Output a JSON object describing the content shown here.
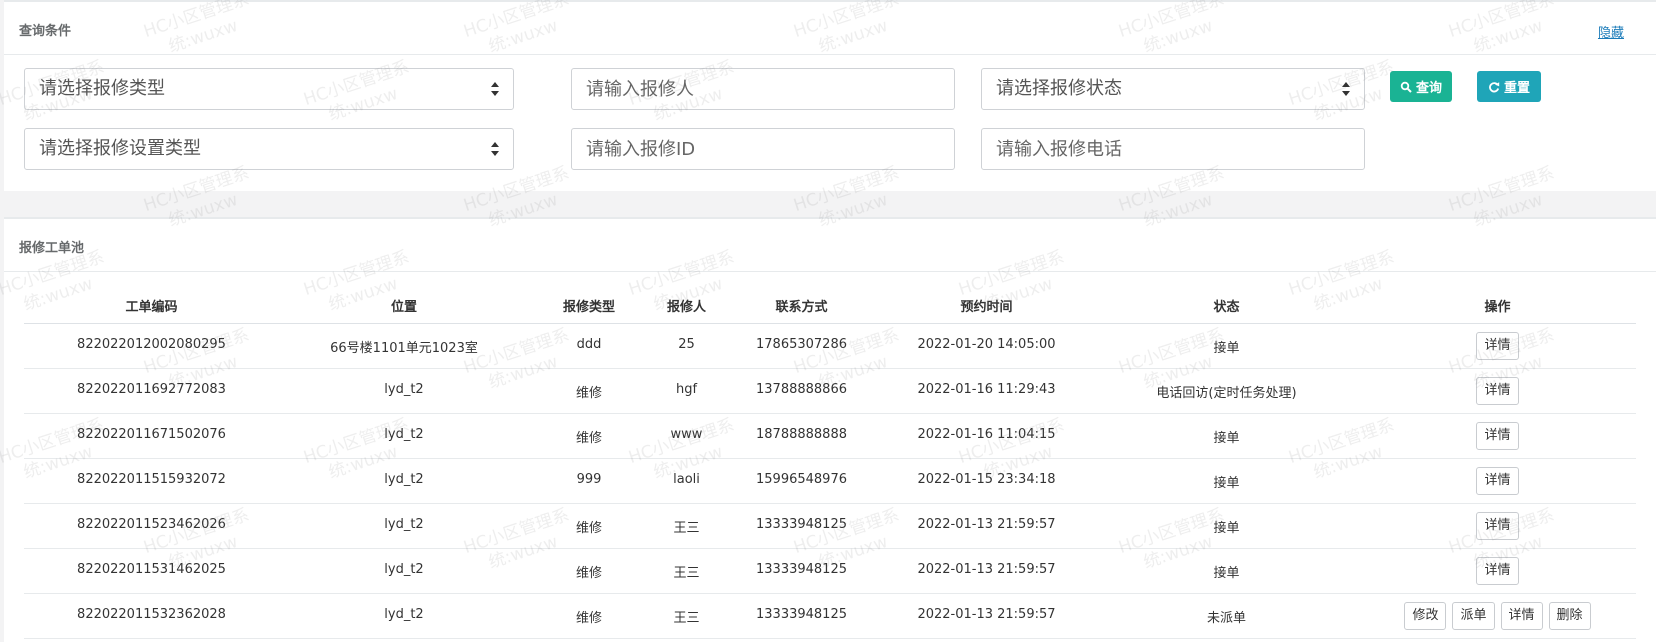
{
  "query_panel": {
    "title": "查询条件",
    "hide_link": "隐藏",
    "repair_type_select": "请选择报修类型",
    "reporter_input_placeholder": "请输入报修人",
    "repair_status_select": "请选择报修状态",
    "repair_setting_type_select": "请选择报修设置类型",
    "repair_id_input_placeholder": "请输入报修ID",
    "repair_phone_input_placeholder": "请输入报修电话",
    "search_button": "查询",
    "reset_button": "重置"
  },
  "pool_panel": {
    "title": "报修工单池",
    "columns": [
      "工单编码",
      "位置",
      "报修类型",
      "报修人",
      "联系方式",
      "预约时间",
      "状态",
      "操作"
    ],
    "rows": [
      {
        "code": "822022012002080295",
        "location": "66号楼1101单元1023室",
        "type": "ddd",
        "reporter": "25",
        "phone": "17865307286",
        "time": "2022-01-20 14:05:00",
        "status": "接单",
        "actions": [
          "详情"
        ]
      },
      {
        "code": "822022011692772083",
        "location": "lyd_t2",
        "type": "维修",
        "reporter": "hgf",
        "phone": "13788888866",
        "time": "2022-01-16 11:29:43",
        "status": "电话回访(定时任务处理)",
        "actions": [
          "详情"
        ]
      },
      {
        "code": "822022011671502076",
        "location": "lyd_t2",
        "type": "维修",
        "reporter": "www",
        "phone": "18788888888",
        "time": "2022-01-16 11:04:15",
        "status": "接单",
        "actions": [
          "详情"
        ]
      },
      {
        "code": "822022011515932072",
        "location": "lyd_t2",
        "type": "999",
        "reporter": "laoli",
        "phone": "15996548976",
        "time": "2022-01-15 23:34:18",
        "status": "接单",
        "actions": [
          "详情"
        ]
      },
      {
        "code": "822022011523462026",
        "location": "lyd_t2",
        "type": "维修",
        "reporter": "王三",
        "phone": "13333948125",
        "time": "2022-01-13 21:59:57",
        "status": "接单",
        "actions": [
          "详情"
        ]
      },
      {
        "code": "822022011531462025",
        "location": "lyd_t2",
        "type": "维修",
        "reporter": "王三",
        "phone": "13333948125",
        "time": "2022-01-13 21:59:57",
        "status": "接单",
        "actions": [
          "详情"
        ]
      },
      {
        "code": "822022011532362028",
        "location": "lyd_t2",
        "type": "维修",
        "reporter": "王三",
        "phone": "13333948125",
        "time": "2022-01-13 21:59:57",
        "status": "未派单",
        "actions": [
          "修改",
          "派单",
          "详情",
          "删除"
        ]
      }
    ]
  },
  "watermark": {
    "line1": "HC小区管理系",
    "line2": "统:wuxw"
  },
  "colors": {
    "search_button": "#1ab394",
    "reset_button": "#1fa5b8",
    "link": "#1a7bb9"
  },
  "icons": {
    "search_button": "search-icon",
    "reset_button": "refresh-icon"
  }
}
